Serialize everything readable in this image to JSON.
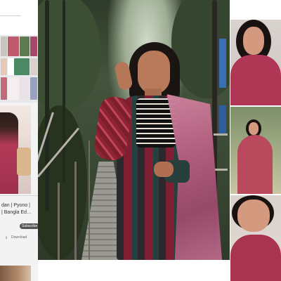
{
  "left_sidebar": {
    "video_title": "dan | Pyono |\n| Bangla Ed…",
    "subscribe_label": "Subscribe",
    "download_label": "Download",
    "download_icon": "download-icon"
  },
  "main_photo": {
    "label": "portrait-photo"
  },
  "right_thumbnails": [
    {
      "name": "thumbnail-1"
    },
    {
      "name": "thumbnail-2"
    },
    {
      "name": "thumbnail-3"
    }
  ],
  "colors": {
    "subscribe_bg": "#555555",
    "dress_maroon": "#7e1f33",
    "dupatta_pink": "#b55f80"
  }
}
